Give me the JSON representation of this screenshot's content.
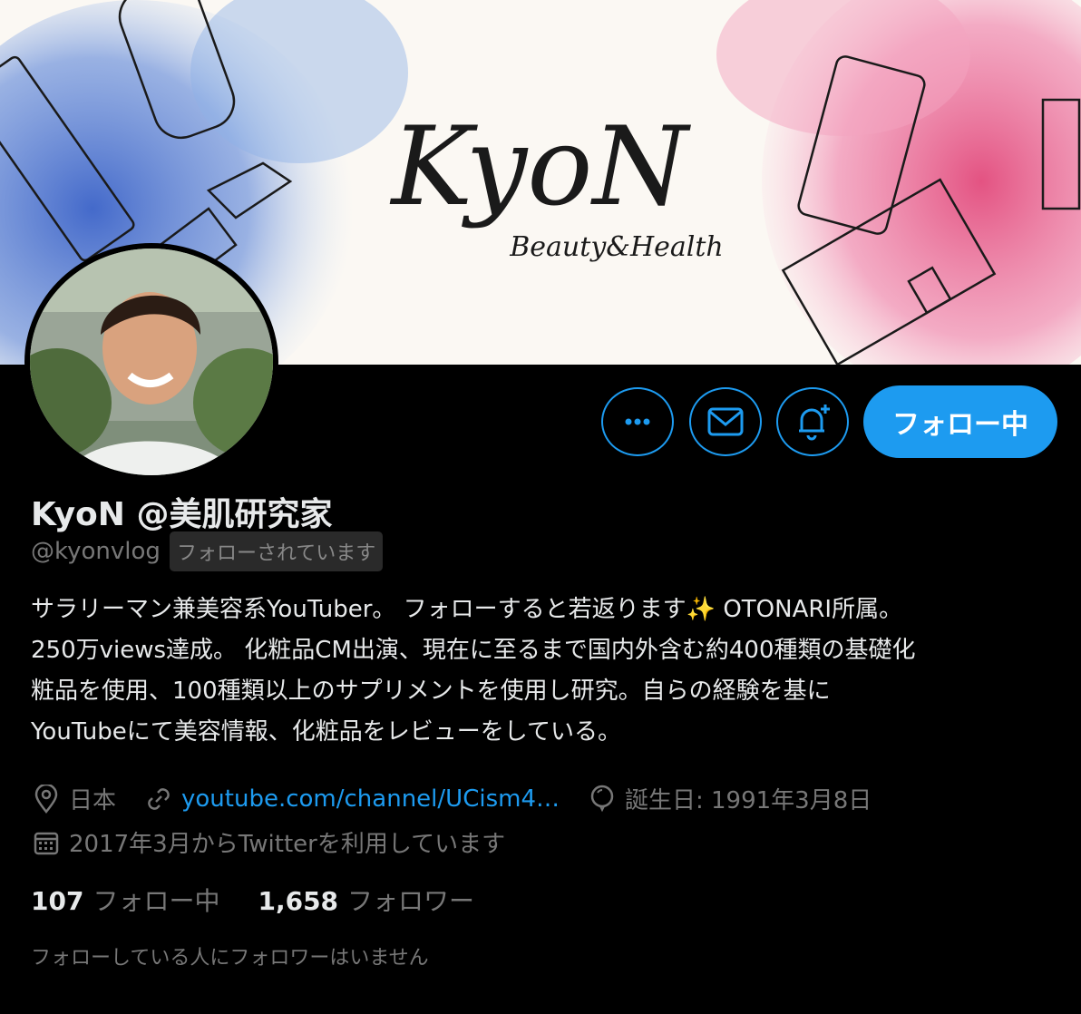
{
  "profile": {
    "display_name": "KyoN @美肌研究家",
    "handle": "@kyonvlog",
    "follows_you_badge": "フォローされています",
    "banner_logo_text": "KyoN",
    "banner_logo_subtext": "Beauty&Health",
    "bio_lines": [
      "サラリーマン兼美容系YouTuber。 フォローすると若返ります✨ OTONARI所属。",
      "250万views達成。 化粧品CM出演、現在に至るまで国内外含む約400種類の基礎化",
      "粧品を使用、100種類以上のサプリメントを使用し研究。自らの経験を基に",
      "YouTubeにて美容情報、化粧品をレビューをしている。"
    ],
    "location": "日本",
    "website": "youtube.com/channel/UCism4…",
    "birthday": "誕生日: 1991年3月8日",
    "joined": "2017年3月からTwitterを利用しています"
  },
  "stats": {
    "following_count": "107",
    "following_label": "フォロー中",
    "followers_count": "1,658",
    "followers_label": "フォロワー"
  },
  "footer_note": "フォローしている人にフォロワーはいません",
  "actions": {
    "follow_button_label": "フォロー中",
    "more_icon": "more-dots-icon",
    "message_icon": "envelope-icon",
    "notify_icon": "bell-plus-icon"
  },
  "colors": {
    "accent": "#1d9bf0",
    "background": "#000000",
    "muted_text": "#777777"
  }
}
